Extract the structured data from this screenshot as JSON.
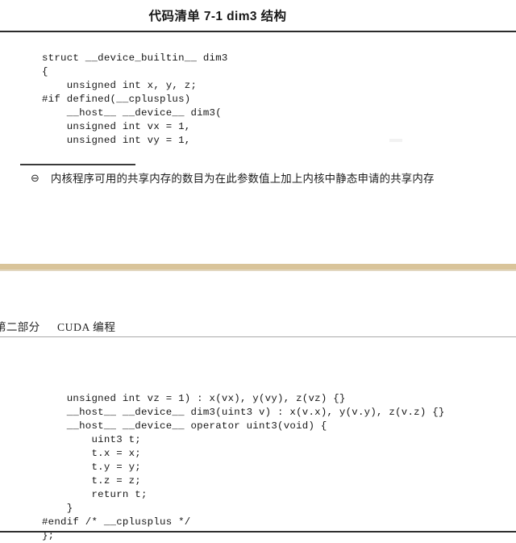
{
  "page": {
    "background_color": "#ffffff",
    "text_color": "#1a1a1a",
    "band_color": "#d9c49a",
    "rule_color": "#2b2b2b"
  },
  "upper_page": {
    "listing_title": "代码清单 7-1    dim3 结构",
    "code": "struct __device_builtin__ dim3\n{\n    unsigned int x, y, z;\n#if defined(__cplusplus)\n    __host__ __device__ dim3(\n    unsigned int vx = 1,\n    unsigned int vy = 1,",
    "footnote": {
      "marker": "⊖",
      "marker_name": "circled-minus",
      "text": "内核程序可用的共享内存的数目为在此参数值上加上内核中静态申请的共享内存"
    }
  },
  "lower_page": {
    "running_head": {
      "part": "第二部分",
      "chapter": "CUDA 编程"
    },
    "code": "    unsigned int vz = 1) : x(vx), y(vy), z(vz) {}\n    __host__ __device__ dim3(uint3 v) : x(v.x), y(v.y), z(v.z) {}\n    __host__ __device__ operator uint3(void) {\n        uint3 t;\n        t.x = x;\n        t.y = y;\n        t.z = z;\n        return t;\n    }\n#endif /* __cplusplus */\n};"
  }
}
